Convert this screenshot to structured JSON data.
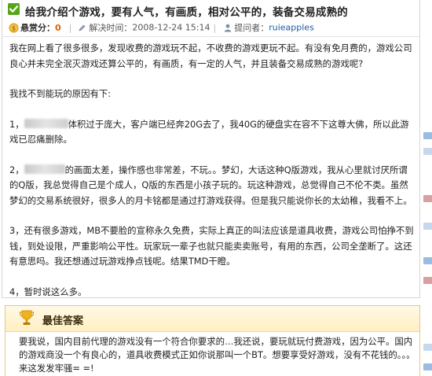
{
  "question": {
    "title": "给我介绍个游戏，要有人气，有画质，相对公平的，装备交易成熟的",
    "reward_label": "悬赏分：",
    "reward_value": "0",
    "time_label": "解决时间：",
    "time_value": "2008-12-24 15:14",
    "author_label": "提问者：",
    "author_name": "ruieapples",
    "paragraphs": [
      "我在网上看了很多很多，发现收费的游戏玩不起，不收费的游戏更玩不起。有没有免月费的，游戏公司良心并未完全泯灭游戏还算公平的，有画质，有一定的人气，并且装备交易成熟的游戏呢?",
      "我找不到能玩的原因有下:"
    ],
    "reason1_prefix": "1，",
    "reason1_text": "体积过于庞大，客户端已经奔20G去了，我40G的硬盘实在容不下这尊大佛，所以此游戏已忍痛删除。",
    "reason2_prefix": "2，",
    "reason2_text": "的画面太差，操作感也非常差，不玩。。梦幻，大话这种Q版游戏，我从心里就讨厌所谓的Q版，我总觉得自己是个成人，Q版的东西是小孩子玩的。玩这种游戏，总觉得自己不伦不类。虽然梦幻的交易系统很好，很多人的月卡铭都是通过打游戏获得。但是我只能说你长的太幼稚，我看不上。",
    "reason3": "3，还有很多游戏，MB不要脸的宣称永久免费，实际上真正的叫法应该是道具收费，游戏公司怕挣不到钱，到处设限，严重影响公平性。玩家玩一辈子也就只能卖卖账号，有用的东西，公司全垄断了。这还有意思吗。我还想通过玩游戏挣点钱呢。结果TMD干瞪。",
    "reason4": "4，暂时说这么多。"
  },
  "best_answer": {
    "title": "最佳答案",
    "text": "要我说，国内目前代理的游戏没有一个符合你要求的…我还说，要玩就玩付费游戏，因为公平。国内的游戏商没一个有良心的，道具收费模式正如你说那叫一个BT。想要享受好游戏，没有不花钱的。。。来这发发牢骚= =!"
  },
  "colors": {
    "accent_green": "#56a517",
    "author_link": "#1d5aa6",
    "reward_orange": "#e06000",
    "best_bg": "#fff3d4"
  },
  "icons": [
    "check-icon",
    "reward-icon",
    "pen-icon",
    "user-icon",
    "trophy-icon"
  ]
}
